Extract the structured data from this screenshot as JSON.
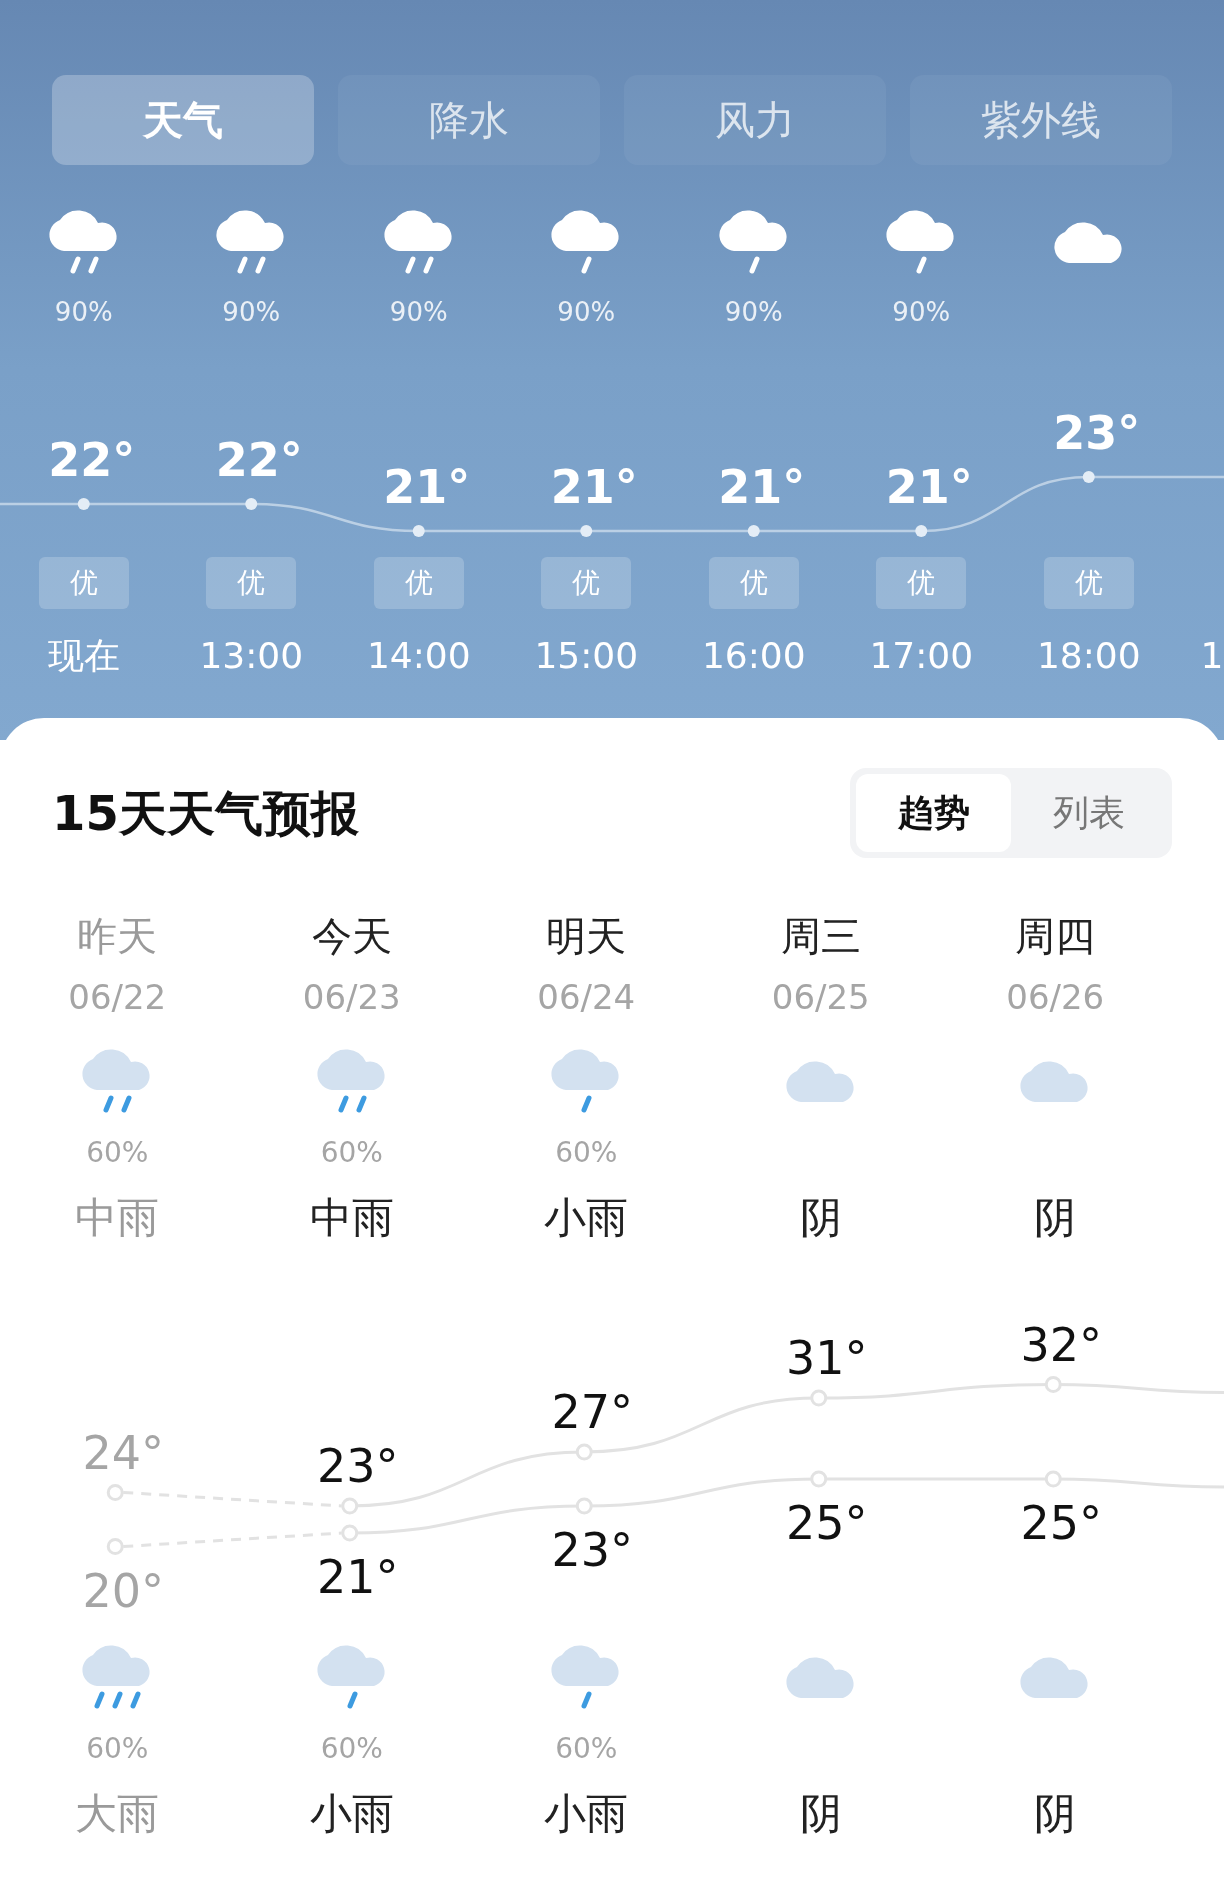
{
  "tabs": [
    {
      "label": "天气",
      "selected": true
    },
    {
      "label": "降水",
      "selected": false
    },
    {
      "label": "风力",
      "selected": false
    },
    {
      "label": "紫外线",
      "selected": false
    }
  ],
  "hourly": [
    {
      "time": "现在",
      "kind": "rain_moderate",
      "chance": "90%",
      "temp": "22°",
      "quality": "优"
    },
    {
      "time": "13:00",
      "kind": "rain_moderate",
      "chance": "90%",
      "temp": "22°",
      "quality": "优"
    },
    {
      "time": "14:00",
      "kind": "rain_moderate",
      "chance": "90%",
      "temp": "21°",
      "quality": "优"
    },
    {
      "time": "15:00",
      "kind": "rain_light",
      "chance": "90%",
      "temp": "21°",
      "quality": "优"
    },
    {
      "time": "16:00",
      "kind": "rain_light",
      "chance": "90%",
      "temp": "21°",
      "quality": "优"
    },
    {
      "time": "17:00",
      "kind": "rain_light",
      "chance": "90%",
      "temp": "21°",
      "quality": "优"
    },
    {
      "time": "18:00",
      "kind": "cloudy",
      "temp": "23°",
      "quality": "优"
    },
    {
      "time": "1"
    }
  ],
  "forecast": {
    "title": "15天天气预报",
    "views": [
      {
        "label": "趋势",
        "selected": true
      },
      {
        "label": "列表",
        "selected": false
      }
    ],
    "days": [
      {
        "name": "昨天",
        "date": "06/22",
        "past": true,
        "high": "24°",
        "low": "20°",
        "day": {
          "kind": "rain_moderate",
          "chance": "60%",
          "condition": "中雨"
        },
        "night": {
          "kind": "rain_heavy",
          "chance": "60%",
          "condition": "大雨"
        }
      },
      {
        "name": "今天",
        "date": "06/23",
        "past": false,
        "high": "23°",
        "low": "21°",
        "day": {
          "kind": "rain_moderate",
          "chance": "60%",
          "condition": "中雨"
        },
        "night": {
          "kind": "rain_light",
          "chance": "60%",
          "condition": "小雨"
        }
      },
      {
        "name": "明天",
        "date": "06/24",
        "past": false,
        "high": "27°",
        "low": "23°",
        "day": {
          "kind": "rain_light",
          "chance": "60%",
          "condition": "小雨"
        },
        "night": {
          "kind": "rain_light",
          "chance": "60%",
          "condition": "小雨"
        }
      },
      {
        "name": "周三",
        "date": "06/25",
        "past": false,
        "high": "31°",
        "low": "25°",
        "day": {
          "kind": "cloudy",
          "condition": "阴"
        },
        "night": {
          "kind": "cloudy",
          "condition": "阴"
        }
      },
      {
        "name": "周四",
        "date": "06/26",
        "past": false,
        "high": "32°",
        "low": "25°",
        "day": {
          "kind": "cloudy",
          "condition": "阴"
        },
        "night": {
          "kind": "cloudy",
          "condition": "阴"
        }
      }
    ]
  }
}
